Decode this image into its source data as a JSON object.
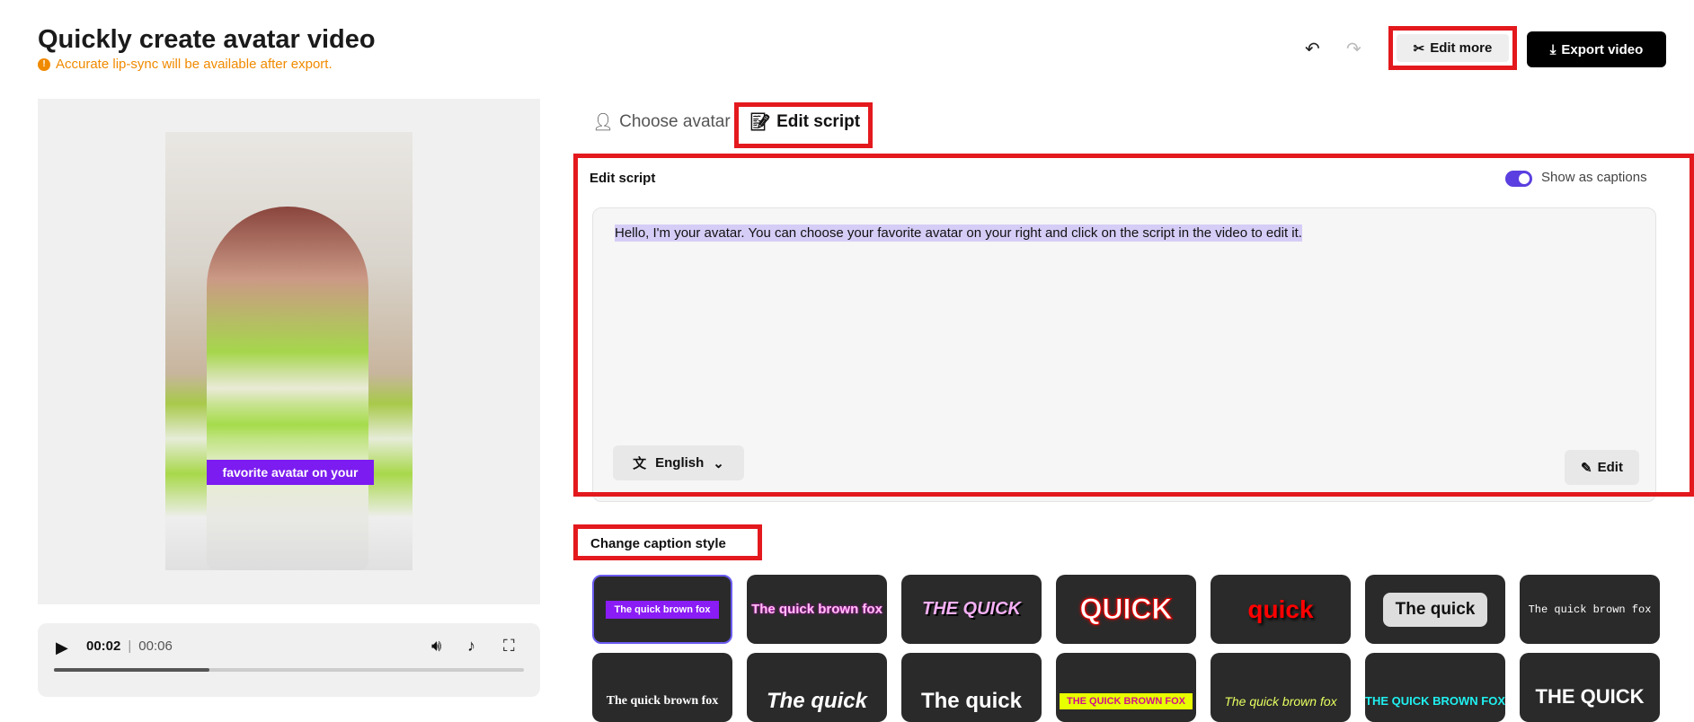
{
  "header": {
    "title": "Quickly create avatar video",
    "warning": "Accurate lip-sync will be available after export.",
    "edit_more": "Edit more",
    "export": "Export video"
  },
  "video": {
    "caption": "favorite avatar on your",
    "current_time": "00:02",
    "duration": "00:06",
    "progress": 0.33
  },
  "tabs": [
    {
      "label": "Choose avatar"
    },
    {
      "label": "Edit script",
      "active": true
    }
  ],
  "script": {
    "heading": "Edit script",
    "toggle_label": "Show as captions",
    "toggle_on": true,
    "text": "Hello, I'm your avatar. You can choose your favorite avatar on your right and click on the script in the video to edit it.",
    "language": "English",
    "edit": "Edit"
  },
  "captions": {
    "heading": "Change caption style",
    "styles": [
      "The quick brown fox",
      "The quick brown fox",
      "THE QUICK",
      "QUICK",
      "quick",
      "The quick",
      "The quick brown fox",
      "The quick brown fox",
      "The quick",
      "The quick",
      "THE QUICK BROWN FOX",
      "The quick brown fox",
      "THE QUICK BROWN FOX",
      "THE QUICK"
    ]
  },
  "colors": {
    "accent": "#5b3fe0",
    "warning": "#f08a00",
    "highlight": "#e3191d"
  }
}
